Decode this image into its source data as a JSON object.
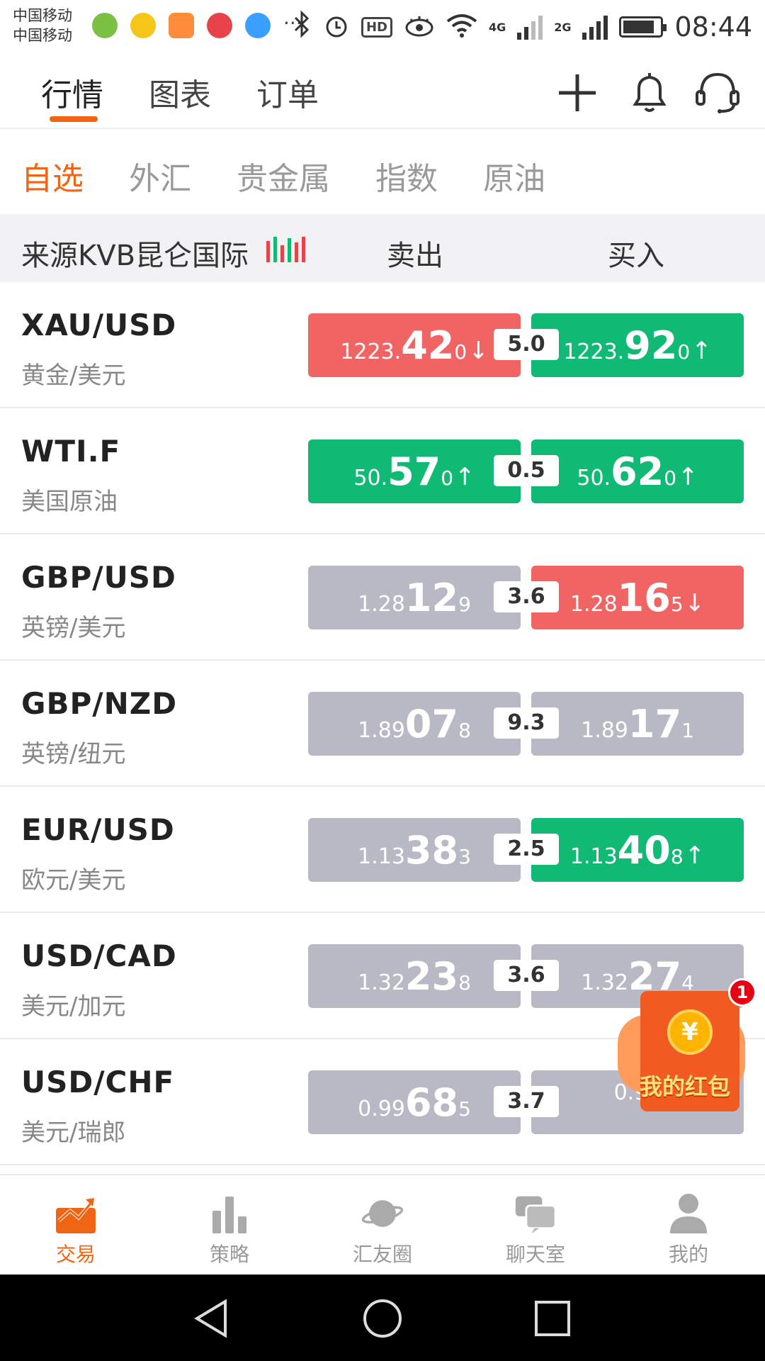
{
  "status_bar": {
    "carrier_1": "中国移动",
    "carrier_2": "中国移动",
    "ellipsis": "···",
    "hd": "HD",
    "net_4g": "4G",
    "net_2g": "2G",
    "time": "08:44",
    "app_icon_colors": [
      "#7bc043",
      "#f5c518",
      "#ff8c3a",
      "#e8434a",
      "#3aa0ff"
    ]
  },
  "top_tabs": [
    {
      "label": "行情",
      "active": true
    },
    {
      "label": "图表",
      "active": false
    },
    {
      "label": "订单",
      "active": false
    }
  ],
  "header_icons": [
    "plus-icon",
    "bell-icon",
    "headset-icon"
  ],
  "category_tabs": [
    {
      "label": "自选",
      "active": true
    },
    {
      "label": "外汇",
      "active": false
    },
    {
      "label": "贵金属",
      "active": false
    },
    {
      "label": "指数",
      "active": false
    },
    {
      "label": "原油",
      "active": false
    }
  ],
  "source_bar": {
    "source_label": "来源KVB昆仑国际",
    "sell_label": "卖出",
    "buy_label": "买入"
  },
  "quotes": [
    {
      "symbol": "XAU/USD",
      "name": "黄金/美元",
      "sell": {
        "prefix": "1223.",
        "big": "42",
        "small": "0",
        "arrow": "↓",
        "color": "red"
      },
      "spread": "5.0",
      "buy": {
        "prefix": "1223.",
        "big": "92",
        "small": "0",
        "arrow": "↑",
        "color": "green"
      }
    },
    {
      "symbol": "WTI.F",
      "name": "美国原油",
      "sell": {
        "prefix": "50.",
        "big": "57",
        "small": "0",
        "arrow": "↑",
        "color": "green"
      },
      "spread": "0.5",
      "buy": {
        "prefix": "50.",
        "big": "62",
        "small": "0",
        "arrow": "↑",
        "color": "green"
      }
    },
    {
      "symbol": "GBP/USD",
      "name": "英镑/美元",
      "sell": {
        "prefix": "1.28",
        "big": "12",
        "small": "9",
        "arrow": "",
        "color": "gray"
      },
      "spread": "3.6",
      "buy": {
        "prefix": "1.28",
        "big": "16",
        "small": "5",
        "arrow": "↓",
        "color": "red"
      }
    },
    {
      "symbol": "GBP/NZD",
      "name": "英镑/纽元",
      "sell": {
        "prefix": "1.89",
        "big": "07",
        "small": "8",
        "arrow": "",
        "color": "gray"
      },
      "spread": "9.3",
      "buy": {
        "prefix": "1.89",
        "big": "17",
        "small": "1",
        "arrow": "",
        "color": "gray"
      }
    },
    {
      "symbol": "EUR/USD",
      "name": "欧元/美元",
      "sell": {
        "prefix": "1.13",
        "big": "38",
        "small": "3",
        "arrow": "",
        "color": "gray"
      },
      "spread": "2.5",
      "buy": {
        "prefix": "1.13",
        "big": "40",
        "small": "8",
        "arrow": "↑",
        "color": "green"
      }
    },
    {
      "symbol": "USD/CAD",
      "name": "美元/加元",
      "sell": {
        "prefix": "1.32",
        "big": "23",
        "small": "8",
        "arrow": "",
        "color": "gray"
      },
      "spread": "3.6",
      "buy": {
        "prefix": "1.32",
        "big": "27",
        "small": "4",
        "arrow": "",
        "color": "gray"
      }
    },
    {
      "symbol": "USD/CHF",
      "name": "美元/瑞郎",
      "sell": {
        "prefix": "0.99",
        "big": "68",
        "small": "5",
        "arrow": "",
        "color": "gray"
      },
      "spread": "3.7",
      "buy": {
        "prefix": "0.99",
        "big": "",
        "small": "",
        "arrow": "",
        "color": "gray"
      }
    }
  ],
  "red_packet": {
    "label": "我的红包",
    "badge": "1",
    "coin": "¥"
  },
  "bottom_nav": [
    {
      "label": "交易",
      "icon": "trade-icon",
      "active": true
    },
    {
      "label": "策略",
      "icon": "strategy-icon",
      "active": false
    },
    {
      "label": "汇友圈",
      "icon": "planet-icon",
      "active": false
    },
    {
      "label": "聊天室",
      "icon": "chat-icon",
      "active": false
    },
    {
      "label": "我的",
      "icon": "profile-icon",
      "active": false
    }
  ],
  "colors": {
    "accent": "#f06414",
    "up": "#10b974",
    "down": "#f06464",
    "neutral": "#b8b9c4"
  }
}
